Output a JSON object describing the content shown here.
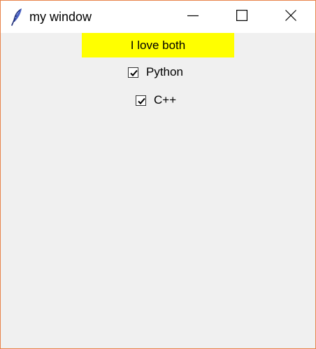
{
  "window": {
    "title": "my window",
    "icon": "feather-icon",
    "border_color": "#e8834a",
    "background": "#f0f0f0",
    "controls": {
      "minimize_icon": "minimize-icon",
      "maximize_icon": "maximize-icon",
      "close_icon": "close-icon"
    }
  },
  "label": {
    "text": "I love both",
    "background": "#ffff00"
  },
  "checkboxes": [
    {
      "label": "Python",
      "checked": true
    },
    {
      "label": "C++",
      "checked": true
    }
  ]
}
